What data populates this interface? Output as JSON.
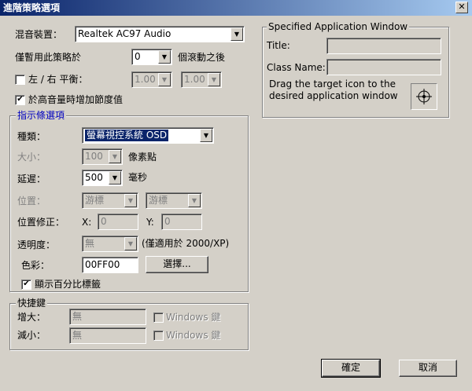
{
  "window": {
    "title": "進階策略選項",
    "close_label": "✕"
  },
  "mixer": {
    "label": "混音裝置：",
    "value": "Realtek AC97 Audio"
  },
  "disable": {
    "label": "僅暫用此策略於",
    "value": "0",
    "suffix": "個滾動之後"
  },
  "balance": {
    "label": "左 / 右 平衡：",
    "left": "1.00",
    "right": "1.00",
    "checked": ""
  },
  "increase": {
    "label": "於高音量時增加節度值",
    "checked": "✔"
  },
  "indicator": {
    "title": "指示條選項",
    "type_label": "種類：",
    "type_value": "螢幕視控系統 OSD",
    "size_label": "大小：",
    "size_value": "100",
    "size_unit": "像素點",
    "delay_label": "延遲：",
    "delay_value": "500",
    "delay_unit": "毫秒",
    "pos_label": "位置：",
    "pos_x": "游標",
    "pos_y": "游標",
    "adjust_label": "位置修正：",
    "x_label": "X:",
    "x_value": "0",
    "y_label": "Y:",
    "y_value": "0",
    "opacity_label": "透明度：",
    "opacity_value": "無",
    "opacity_note": "(僅適用於 2000/XP)",
    "color_label": "色彩：",
    "color_value": "00FF00",
    "choose_label": "選擇...",
    "percent_label": "顯示百分比標籤",
    "percent_checked": "✔"
  },
  "hotkeys": {
    "title": "快捷鍵",
    "increase_label": "增大：",
    "increase_value": "無",
    "increase_win": "Windows 鍵",
    "decrease_label": "減小：",
    "decrease_value": "無",
    "decrease_win": "Windows 鍵"
  },
  "app_window": {
    "title": "Specified Application Window",
    "title_label": "Title:",
    "title_value": "",
    "class_label": "Class Name:",
    "class_value": "",
    "drag_text": "Drag the target icon to the desired application window"
  },
  "buttons": {
    "ok": "確定",
    "cancel": "取消"
  },
  "colors": {
    "titlebar_start": "#0a246a",
    "titlebar_end": "#a6caf0",
    "face": "#d4d0c8",
    "group_title": "#0000c0"
  }
}
